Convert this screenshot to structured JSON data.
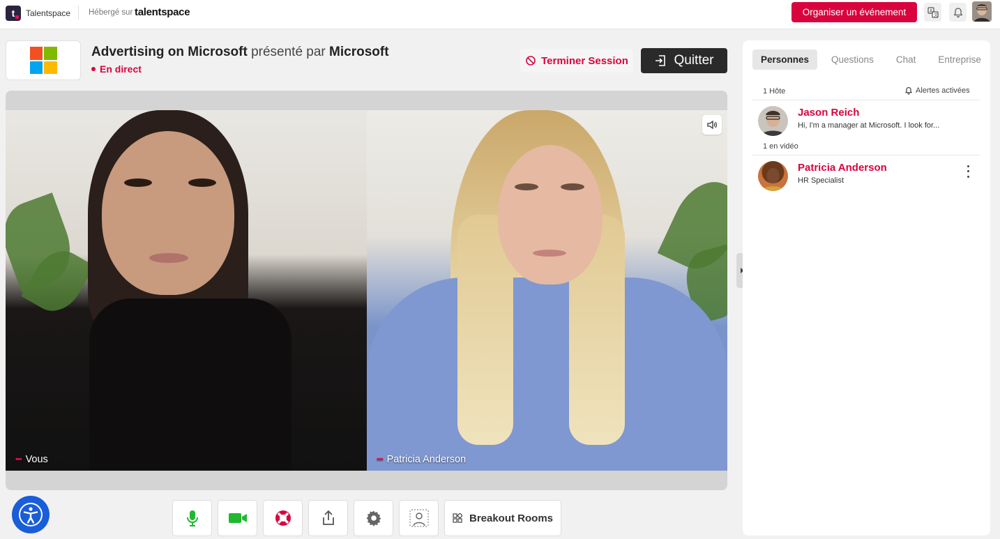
{
  "topbar": {
    "logo_letter": "t",
    "app_name": "Talentspace",
    "hosted_on": "Hébergé sur",
    "hosted_brand": "talentspace",
    "organize_label": "Organiser un événement",
    "icons": [
      "translate-icon",
      "bell-icon",
      "user-avatar"
    ]
  },
  "session": {
    "company": "Microsoft",
    "title": "Advertising on Microsoft",
    "presented_by": "présenté par",
    "status": "En direct",
    "end_label": "Terminer Session",
    "quit_label": "Quitter"
  },
  "videos": [
    {
      "label": "Vous"
    },
    {
      "label": "Patricia Anderson"
    }
  ],
  "controls": {
    "breakout_label": "Breakout Rooms",
    "buttons": [
      "microphone-icon",
      "camera-icon",
      "lifebuoy-icon",
      "share-icon",
      "settings-icon",
      "background-blur-icon"
    ]
  },
  "sidebar": {
    "tabs": [
      "Personnes",
      "Questions",
      "Chat",
      "Entreprise"
    ],
    "active_tab": "Personnes",
    "host_section": "1 Hôte",
    "alerts_label": "Alertes activées",
    "host": {
      "name": "Jason Reich",
      "subtitle": "Hi, I'm a manager at Microsoft. I look for..."
    },
    "video_section": "1 en vidéo",
    "video_person": {
      "name": "Patricia Anderson",
      "subtitle": "HR Specialist"
    }
  },
  "colors": {
    "accent": "#d9043d",
    "dark_button": "#2a2a2a",
    "accessibility": "#1a5dd8",
    "mic_green": "#1fb830"
  }
}
